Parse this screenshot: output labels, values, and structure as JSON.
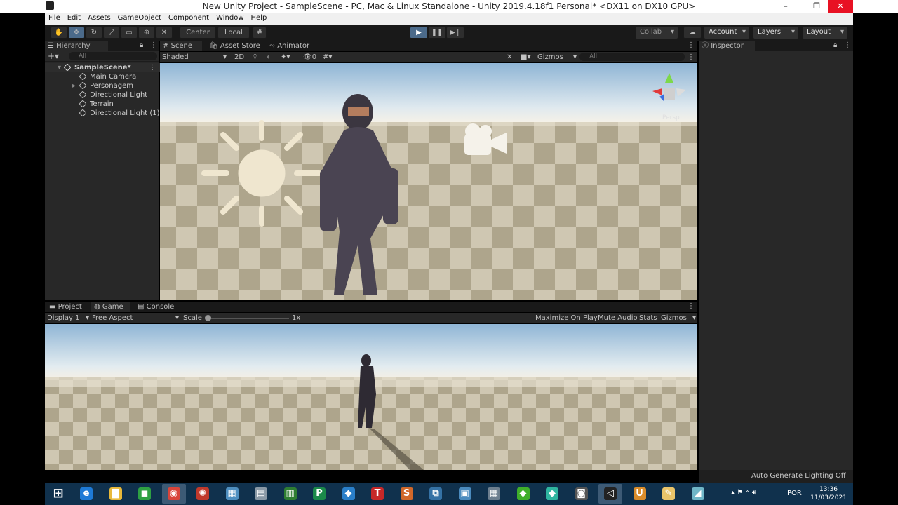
{
  "window": {
    "title": "New Unity Project - SampleScene - PC, Mac & Linux Standalone - Unity 2019.4.18f1 Personal* <DX11 on DX10 GPU>",
    "minimize": "–",
    "restore": "❐",
    "close": "✕"
  },
  "menu": [
    "File",
    "Edit",
    "Assets",
    "GameObject",
    "Component",
    "Window",
    "Help"
  ],
  "toolbar": {
    "pivot": "Center",
    "space": "Local",
    "collab": "Collab",
    "account": "Account",
    "layers": "Layers",
    "layout": "Layout"
  },
  "hierarchy": {
    "tab": "Hierarchy",
    "search_placeholder": "All",
    "scene": "SampleScene*",
    "items": [
      "Main Camera",
      "Personagem",
      "Directional Light",
      "Terrain",
      "Directional Light (1)"
    ]
  },
  "scene_tabs": [
    "Scene",
    "Asset Store",
    "Animator"
  ],
  "scene_bar": {
    "shading": "Shaded",
    "mode": "2D",
    "hidden_count": "0",
    "gizmos": "Gizmos",
    "search_placeholder": "All",
    "gizmo_label": "Persp"
  },
  "inspector": {
    "tab": "Inspector"
  },
  "bottom_tabs": [
    "Project",
    "Game",
    "Console"
  ],
  "game_bar": {
    "display": "Display 1",
    "aspect": "Free Aspect",
    "scale_label": "Scale",
    "scale_value": "1x",
    "maximize": "Maximize On Play",
    "mute": "Mute Audio",
    "stats": "Stats",
    "gizmos": "Gizmos"
  },
  "status": "Auto Generate Lighting Off",
  "taskbar": {
    "language": "POR",
    "time": "13:36",
    "date": "11/03/2021",
    "apps": [
      {
        "icon": "edge-ie-icon",
        "color": "#1e7ad6",
        "glyph": "e"
      },
      {
        "icon": "file-explorer-icon",
        "color": "#e8b93a",
        "glyph": "▇"
      },
      {
        "icon": "store-icon",
        "color": "#2ea043",
        "glyph": "◼"
      },
      {
        "icon": "chrome-icon",
        "color": "#d9453b",
        "glyph": "◉"
      },
      {
        "icon": "davinci-icon",
        "color": "#c0392b",
        "glyph": "✺"
      },
      {
        "icon": "network-app-icon",
        "color": "#4f8fc0",
        "glyph": "▦"
      },
      {
        "icon": "printer-app-icon",
        "color": "#8a99a6",
        "glyph": "▤"
      },
      {
        "icon": "project-icon",
        "color": "#2e7d32",
        "glyph": "▥"
      },
      {
        "icon": "publisher-icon",
        "color": "#1b8a4a",
        "glyph": "P"
      },
      {
        "icon": "azure-icon",
        "color": "#2a7fc9",
        "glyph": "◆"
      },
      {
        "icon": "t-app-icon",
        "color": "#c62828",
        "glyph": "T"
      },
      {
        "icon": "s-app-icon",
        "color": "#d1682a",
        "glyph": "S"
      },
      {
        "icon": "python-icon",
        "color": "#3572a5",
        "glyph": "⧉"
      },
      {
        "icon": "python-doc-icon",
        "color": "#4b8bbe",
        "glyph": "▣"
      },
      {
        "icon": "calculator-icon",
        "color": "#6d7f8f",
        "glyph": "▦"
      },
      {
        "icon": "sims-icon",
        "color": "#3fae2a",
        "glyph": "◆"
      },
      {
        "icon": "sims-2-icon",
        "color": "#2fb5a0",
        "glyph": "◆"
      },
      {
        "icon": "camera-app-icon",
        "color": "#555555",
        "glyph": "◙"
      },
      {
        "icon": "unity-icon",
        "color": "#222222",
        "glyph": "◁"
      },
      {
        "icon": "unity-hub-icon",
        "color": "#d98c2b",
        "glyph": "U"
      },
      {
        "icon": "paint-icon",
        "color": "#e9c46a",
        "glyph": "✎"
      },
      {
        "icon": "app-icon",
        "color": "#6fb6c8",
        "glyph": "◢"
      }
    ]
  },
  "colors": {
    "sky_top": "#96b9d6",
    "horizon": "#f1efe7",
    "ground_light": "#cfc7b2",
    "ground_dark": "#aea58c",
    "play_accent": "#4b6a8a"
  }
}
